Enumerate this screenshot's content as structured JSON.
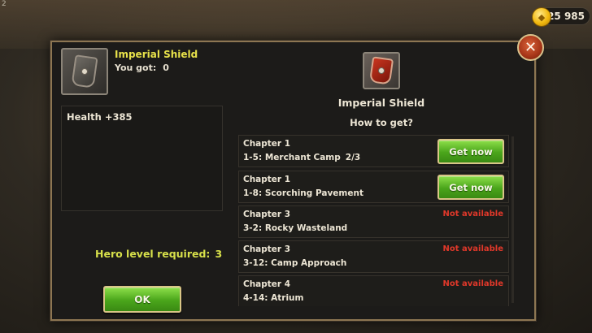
{
  "corner_number": "2",
  "currency": {
    "amount": "25 985",
    "icon": "coin-icon"
  },
  "dialog": {
    "item_name": "Imperial Shield",
    "you_got_label": "You got:",
    "you_got_value": "0",
    "stats": [
      "Health +385"
    ],
    "hero_level_label": "Hero level required:",
    "hero_level_value": "3",
    "ok_label": "OK",
    "right_title": "Imperial Shield",
    "how_to_get": "How to get?",
    "sources": [
      {
        "chapter": "Chapter 1",
        "stage": "1-5: Merchant Camp",
        "progress": "2/3",
        "action": "Get now",
        "available": true
      },
      {
        "chapter": "Chapter 1",
        "stage": "1-8: Scorching Pavement",
        "progress": "",
        "action": "Get now",
        "available": true
      },
      {
        "chapter": "Chapter 3",
        "stage": "3-2: Rocky Wasteland",
        "progress": "",
        "action": "Not available",
        "available": false
      },
      {
        "chapter": "Chapter 3",
        "stage": "3-12: Camp Approach",
        "progress": "",
        "action": "Not available",
        "available": false
      },
      {
        "chapter": "Chapter 4",
        "stage": "4-14: Atrium",
        "progress": "",
        "action": "Not available",
        "available": false
      }
    ]
  },
  "colors": {
    "item_title": "#e8e24a",
    "hero_level": "#d7e04a",
    "not_available": "#e0382a",
    "button_green": "#4aa51b"
  }
}
